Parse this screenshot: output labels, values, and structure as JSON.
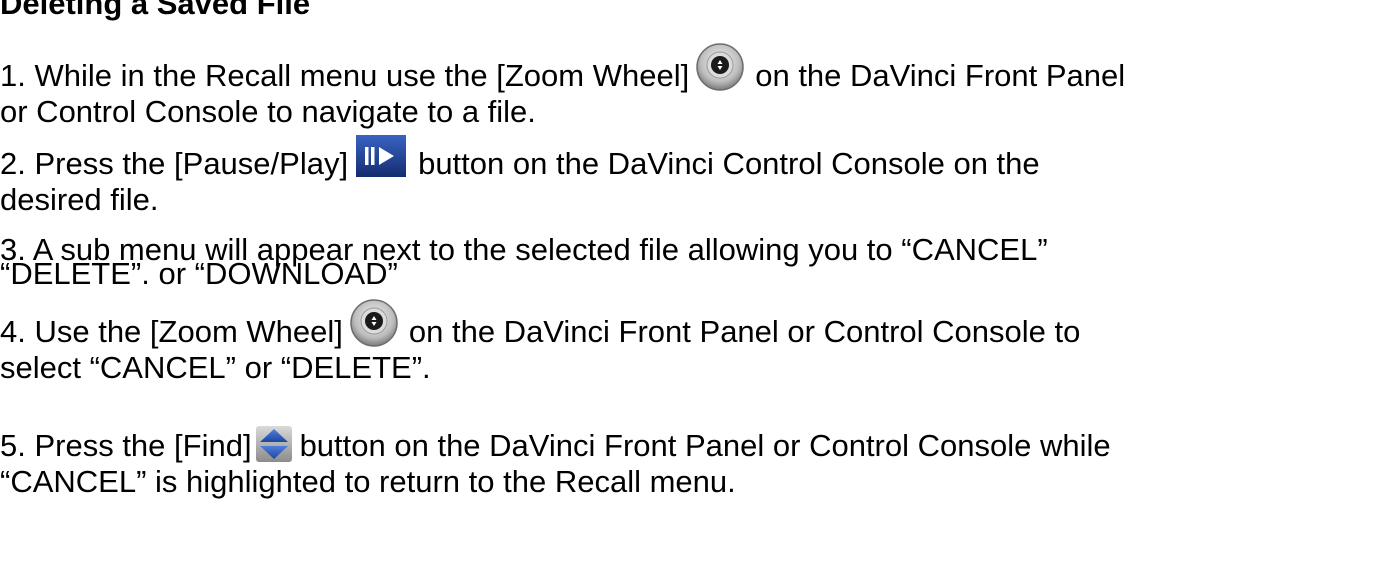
{
  "heading": "Deleting a Saved File",
  "steps": {
    "s1": {
      "before": "1. While in the Recall menu use the [Zoom Wheel]",
      "after": "on the DaVinci Front Panel",
      "line2": "or Control Console to navigate to a file.",
      "icon": "zoom-wheel-icon"
    },
    "s2": {
      "before": "2. Press the [Pause/Play]",
      "after": "button on the DaVinci Control Console on the",
      "line2": "desired file.",
      "icon": "pause-play-icon"
    },
    "s3": {
      "line1": "3. A sub menu will appear next to the selected file allowing you to “CANCEL”",
      "line2": "“DELETE”. or “DOWNLOAD”"
    },
    "s4": {
      "before": "4. Use the [Zoom Wheel]",
      "after": "on the DaVinci Front Panel or Control Console to",
      "line2": "select “CANCEL” or “DELETE”.",
      "icon": "zoom-wheel-icon"
    },
    "s5": {
      "before": "5. Press the [Find]",
      "after": "button on the DaVinci Front Panel or Control Console while",
      "line2": "“CANCEL” is highlighted to return to the Recall menu.",
      "icon": "find-arrows-icon"
    }
  },
  "colors": {
    "wheel_ring": "#8a8a8a",
    "wheel_center": "#1a1a1a",
    "pause_play_bg": "#1f3f8f",
    "find_arrows": "#2b5ab8"
  }
}
